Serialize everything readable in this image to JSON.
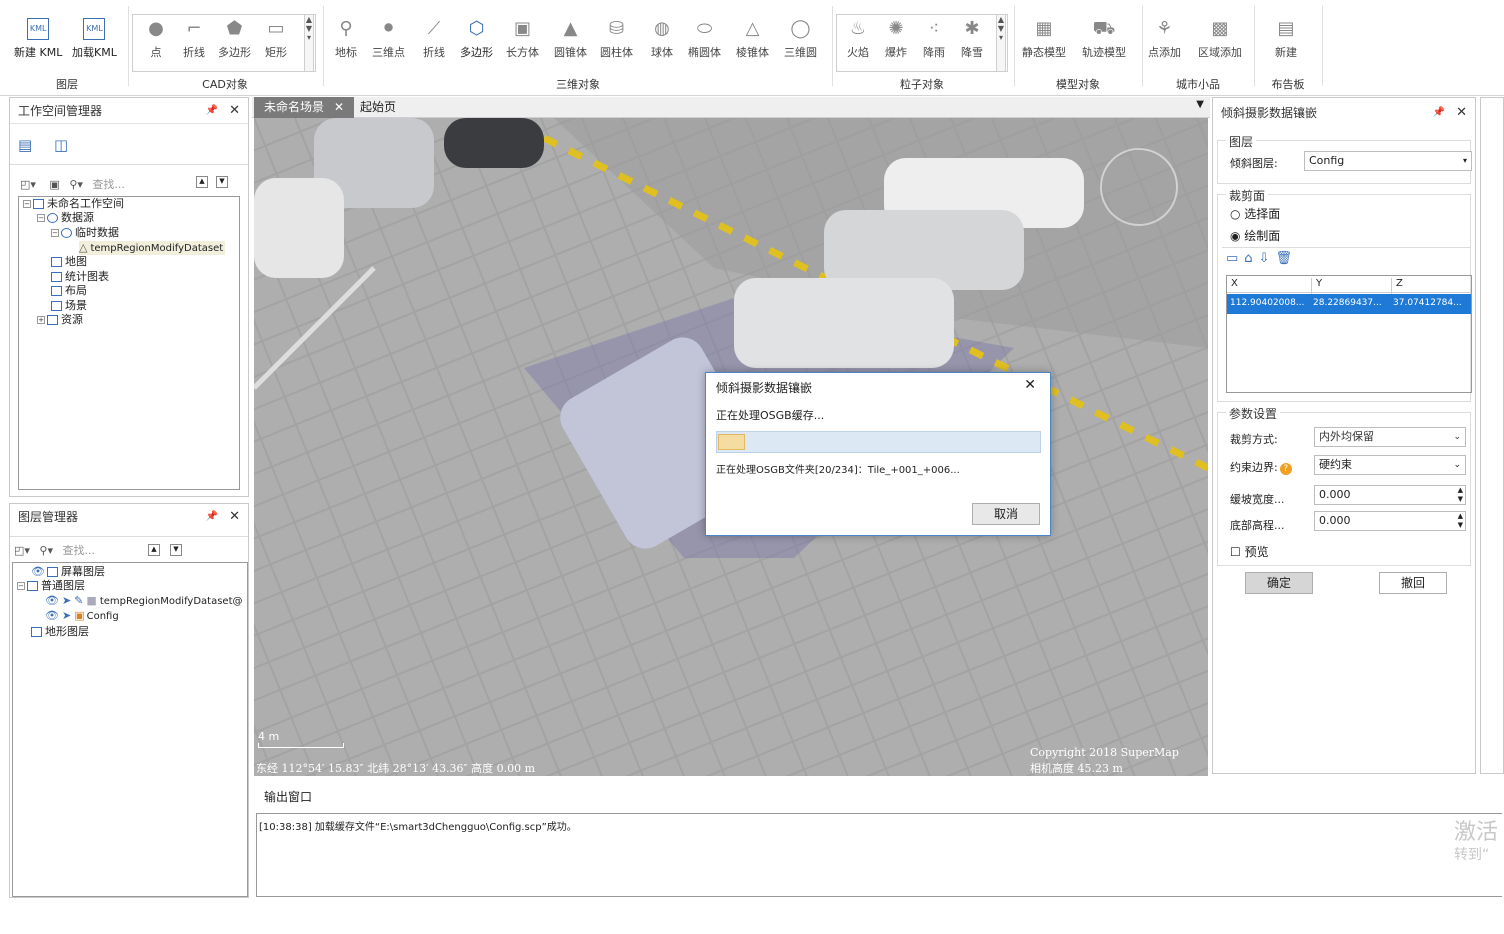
{
  "ribbon": {
    "layer_group": {
      "label": "图层",
      "buttons": [
        "新建 KML",
        "加载KML"
      ]
    },
    "cad_group": {
      "label": "CAD对象",
      "buttons": [
        "点",
        "折线",
        "多边形",
        "矩形"
      ]
    },
    "obj3d_group": {
      "label": "三维对象",
      "buttons": [
        "地标",
        "三维点",
        "折线",
        "多边形",
        "长方体",
        "圆锥体",
        "圆柱体",
        "球体",
        "椭圆体",
        "棱锥体",
        "三维圆"
      ]
    },
    "particle_group": {
      "label": "粒子对象",
      "buttons": [
        "火焰",
        "爆炸",
        "降雨",
        "降雪"
      ]
    },
    "model_group": {
      "label": "模型对象",
      "buttons": [
        "静态模型",
        "轨迹模型"
      ]
    },
    "city_group": {
      "label": "城市小品",
      "buttons": [
        "点添加",
        "区域添加"
      ]
    },
    "billboard_group": {
      "label": "布告板",
      "buttons": [
        "新建"
      ]
    }
  },
  "workspace_panel": {
    "title": "工作空间管理器",
    "search_placeholder": "查找...",
    "tree": [
      "未命名工作空间",
      "数据源",
      "临时数据",
      "tempRegionModifyDataset",
      "地图",
      "统计图表",
      "布局",
      "场景",
      "资源"
    ]
  },
  "layer_panel": {
    "title": "图层管理器",
    "search_placeholder": "查找...",
    "tree": [
      "屏幕图层",
      "普通图层",
      "tempRegionModifyDataset@",
      "Config",
      "地形图层"
    ]
  },
  "tabs": [
    "未命名场景",
    "起始页"
  ],
  "scene": {
    "scale_label": "4 m",
    "status": "东经 112°54′ 15.83″  北纬 28°13′ 43.36″  高度 0.00 m",
    "copyright": "Copyright 2018 SuperMap",
    "camera_height": "相机高度 45.23 m"
  },
  "progress_dialog": {
    "title": "倾斜摄影数据镶嵌",
    "message": "正在处理OSGB缓存...",
    "detail": "正在处理OSGB文件夹[20/234]：Tile_+001_+006...",
    "cancel_label": "取消",
    "progress": 0.085
  },
  "mosaic_panel": {
    "title": "倾斜摄影数据镶嵌",
    "layer_section": "图层",
    "layer_label": "倾斜图层:",
    "layer_value": "Config",
    "clip_section": "裁剪面",
    "radio_select": "选择面",
    "radio_draw": "绘制面",
    "table_headers": [
      "X",
      "Y",
      "Z"
    ],
    "table_row": [
      "112.90402008...",
      "28.22869437...",
      "37.07412784..."
    ],
    "params_section": "参数设置",
    "clip_mode_label": "裁剪方式:",
    "clip_mode_value": "内外均保留",
    "constraint_label": "约束边界:",
    "constraint_value": "硬约束",
    "slope_label": "缓坡宽度...",
    "slope_value": "0.000",
    "bottom_label": "底部高程...",
    "bottom_value": "0.000",
    "preview_label": "预览",
    "ok_label": "确定",
    "cancel_label": "撤回"
  },
  "output": {
    "title": "输出窗口",
    "log": "[10:38:38] 加载缓存文件“E:\\smart3dChengguo\\Config.scp”成功。"
  },
  "watermark": {
    "line1": "激活",
    "line2": "转到“"
  }
}
